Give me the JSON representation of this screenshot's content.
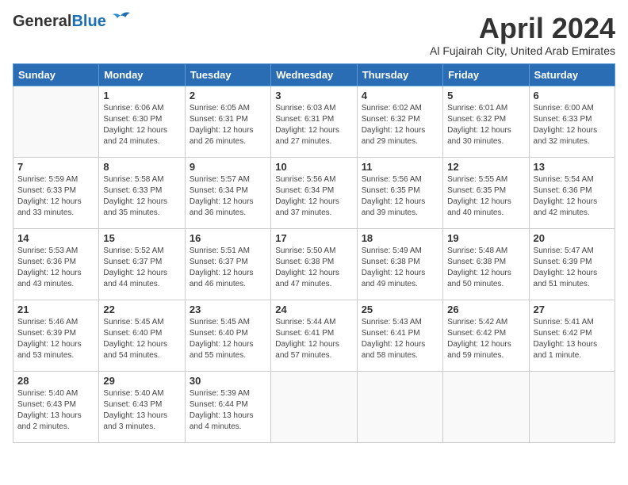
{
  "header": {
    "logo_line1": "General",
    "logo_line2": "Blue",
    "month_title": "April 2024",
    "subtitle": "Al Fujairah City, United Arab Emirates"
  },
  "weekdays": [
    "Sunday",
    "Monday",
    "Tuesday",
    "Wednesday",
    "Thursday",
    "Friday",
    "Saturday"
  ],
  "weeks": [
    [
      {
        "day": "",
        "info": ""
      },
      {
        "day": "1",
        "info": "Sunrise: 6:06 AM\nSunset: 6:30 PM\nDaylight: 12 hours\nand 24 minutes."
      },
      {
        "day": "2",
        "info": "Sunrise: 6:05 AM\nSunset: 6:31 PM\nDaylight: 12 hours\nand 26 minutes."
      },
      {
        "day": "3",
        "info": "Sunrise: 6:03 AM\nSunset: 6:31 PM\nDaylight: 12 hours\nand 27 minutes."
      },
      {
        "day": "4",
        "info": "Sunrise: 6:02 AM\nSunset: 6:32 PM\nDaylight: 12 hours\nand 29 minutes."
      },
      {
        "day": "5",
        "info": "Sunrise: 6:01 AM\nSunset: 6:32 PM\nDaylight: 12 hours\nand 30 minutes."
      },
      {
        "day": "6",
        "info": "Sunrise: 6:00 AM\nSunset: 6:33 PM\nDaylight: 12 hours\nand 32 minutes."
      }
    ],
    [
      {
        "day": "7",
        "info": "Sunrise: 5:59 AM\nSunset: 6:33 PM\nDaylight: 12 hours\nand 33 minutes."
      },
      {
        "day": "8",
        "info": "Sunrise: 5:58 AM\nSunset: 6:33 PM\nDaylight: 12 hours\nand 35 minutes."
      },
      {
        "day": "9",
        "info": "Sunrise: 5:57 AM\nSunset: 6:34 PM\nDaylight: 12 hours\nand 36 minutes."
      },
      {
        "day": "10",
        "info": "Sunrise: 5:56 AM\nSunset: 6:34 PM\nDaylight: 12 hours\nand 37 minutes."
      },
      {
        "day": "11",
        "info": "Sunrise: 5:56 AM\nSunset: 6:35 PM\nDaylight: 12 hours\nand 39 minutes."
      },
      {
        "day": "12",
        "info": "Sunrise: 5:55 AM\nSunset: 6:35 PM\nDaylight: 12 hours\nand 40 minutes."
      },
      {
        "day": "13",
        "info": "Sunrise: 5:54 AM\nSunset: 6:36 PM\nDaylight: 12 hours\nand 42 minutes."
      }
    ],
    [
      {
        "day": "14",
        "info": "Sunrise: 5:53 AM\nSunset: 6:36 PM\nDaylight: 12 hours\nand 43 minutes."
      },
      {
        "day": "15",
        "info": "Sunrise: 5:52 AM\nSunset: 6:37 PM\nDaylight: 12 hours\nand 44 minutes."
      },
      {
        "day": "16",
        "info": "Sunrise: 5:51 AM\nSunset: 6:37 PM\nDaylight: 12 hours\nand 46 minutes."
      },
      {
        "day": "17",
        "info": "Sunrise: 5:50 AM\nSunset: 6:38 PM\nDaylight: 12 hours\nand 47 minutes."
      },
      {
        "day": "18",
        "info": "Sunrise: 5:49 AM\nSunset: 6:38 PM\nDaylight: 12 hours\nand 49 minutes."
      },
      {
        "day": "19",
        "info": "Sunrise: 5:48 AM\nSunset: 6:38 PM\nDaylight: 12 hours\nand 50 minutes."
      },
      {
        "day": "20",
        "info": "Sunrise: 5:47 AM\nSunset: 6:39 PM\nDaylight: 12 hours\nand 51 minutes."
      }
    ],
    [
      {
        "day": "21",
        "info": "Sunrise: 5:46 AM\nSunset: 6:39 PM\nDaylight: 12 hours\nand 53 minutes."
      },
      {
        "day": "22",
        "info": "Sunrise: 5:45 AM\nSunset: 6:40 PM\nDaylight: 12 hours\nand 54 minutes."
      },
      {
        "day": "23",
        "info": "Sunrise: 5:45 AM\nSunset: 6:40 PM\nDaylight: 12 hours\nand 55 minutes."
      },
      {
        "day": "24",
        "info": "Sunrise: 5:44 AM\nSunset: 6:41 PM\nDaylight: 12 hours\nand 57 minutes."
      },
      {
        "day": "25",
        "info": "Sunrise: 5:43 AM\nSunset: 6:41 PM\nDaylight: 12 hours\nand 58 minutes."
      },
      {
        "day": "26",
        "info": "Sunrise: 5:42 AM\nSunset: 6:42 PM\nDaylight: 12 hours\nand 59 minutes."
      },
      {
        "day": "27",
        "info": "Sunrise: 5:41 AM\nSunset: 6:42 PM\nDaylight: 13 hours\nand 1 minute."
      }
    ],
    [
      {
        "day": "28",
        "info": "Sunrise: 5:40 AM\nSunset: 6:43 PM\nDaylight: 13 hours\nand 2 minutes."
      },
      {
        "day": "29",
        "info": "Sunrise: 5:40 AM\nSunset: 6:43 PM\nDaylight: 13 hours\nand 3 minutes."
      },
      {
        "day": "30",
        "info": "Sunrise: 5:39 AM\nSunset: 6:44 PM\nDaylight: 13 hours\nand 4 minutes."
      },
      {
        "day": "",
        "info": ""
      },
      {
        "day": "",
        "info": ""
      },
      {
        "day": "",
        "info": ""
      },
      {
        "day": "",
        "info": ""
      }
    ]
  ]
}
